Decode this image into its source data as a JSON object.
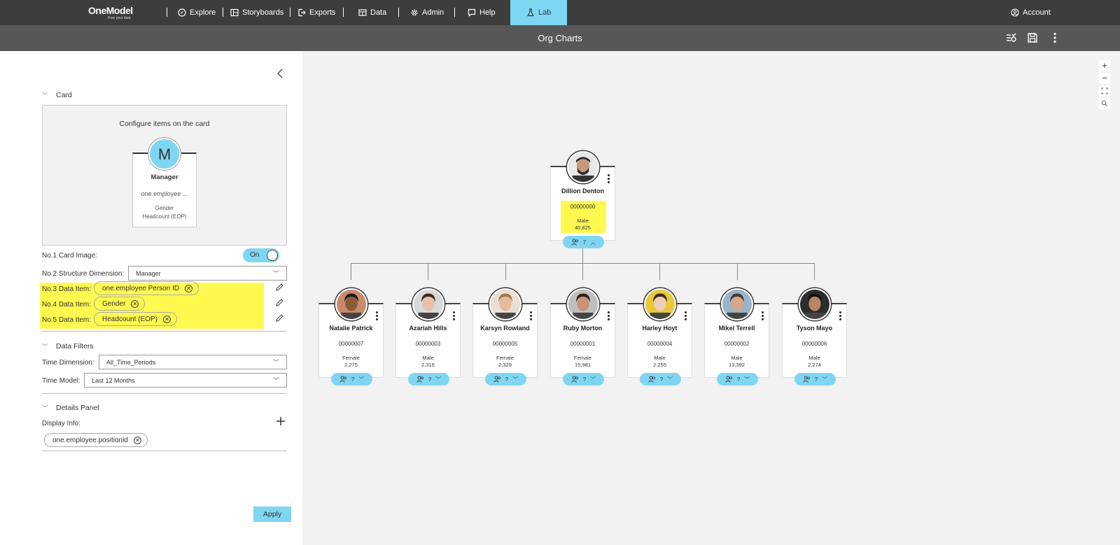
{
  "app": {
    "logo_text": "OneModel",
    "logo_tagline": "Free your data"
  },
  "nav": {
    "items": [
      {
        "label": "Explore",
        "icon": "compass-icon"
      },
      {
        "label": "Storyboards",
        "icon": "storyboard-icon"
      },
      {
        "label": "Exports",
        "icon": "export-icon"
      },
      {
        "label": "Data",
        "icon": "data-icon"
      },
      {
        "label": "Admin",
        "icon": "gear-icon"
      },
      {
        "label": "Help",
        "icon": "help-icon"
      },
      {
        "label": "Lab",
        "icon": "lab-icon",
        "active": true
      }
    ],
    "account": "Account"
  },
  "subbar": {
    "title": "Org Charts"
  },
  "panel": {
    "card_section": "Card",
    "configure_title": "Configure items on the card",
    "preview": {
      "avatar_letter": "M",
      "title": "Manager",
      "line1": "one.employee ...",
      "line2": "Gender",
      "line3": "Headcount (EOP)"
    },
    "card_image_label": "No.1 Card Image:",
    "card_image_toggle": "On",
    "structure_label": "No.2 Structure Dimension:",
    "structure_value": "Manager",
    "data_items": [
      {
        "label": "No.3 Data Item:",
        "value": "one.employee Person ID"
      },
      {
        "label": "No.4 Data Item:",
        "value": "Gender"
      },
      {
        "label": "No.5 Data Item:",
        "value": "Headcount (EOP)"
      }
    ],
    "filters_section": "Data Filters",
    "time_dimension_label": "Time Dimension:",
    "time_dimension_value": "All_Time_Periods",
    "time_model_label": "Time Model:",
    "time_model_value": "Last 12 Months",
    "details_section": "Details Panel",
    "display_info_label": "Display Info:",
    "display_info_chip": "one.employee.positionid",
    "apply": "Apply"
  },
  "zoom": {
    "in": "+",
    "out": "−"
  },
  "org": {
    "root": {
      "name": "Dillion Denton",
      "id": "00000000",
      "gender": "Male",
      "headcount": "40,825",
      "reports": "7"
    },
    "children": [
      {
        "name": "Natalie Patrick",
        "id": "00000007",
        "gender": "Female",
        "headcount": "2,275",
        "reports": "?",
        "skin": "#8a5a3c",
        "hair": "#1a1a1a",
        "bg": "#c98b6a"
      },
      {
        "name": "Azariah Hills",
        "id": "00000003",
        "gender": "Male",
        "headcount": "2,316",
        "reports": "?",
        "skin": "#e6c2a8",
        "hair": "#3a2a20",
        "bg": "#d9d9d9"
      },
      {
        "name": "Karsyn Rowland",
        "id": "00000005",
        "gender": "Female",
        "headcount": "2,329",
        "reports": "?",
        "skin": "#e7b99b",
        "hair": "#a8754a",
        "bg": "#e9dfd6"
      },
      {
        "name": "Ruby Morton",
        "id": "00000001",
        "gender": "Female",
        "headcount": "15,981",
        "reports": "?",
        "skin": "#c99473",
        "hair": "#2b1d16",
        "bg": "#bfbfbf"
      },
      {
        "name": "Harley Hoyt",
        "id": "00000004",
        "gender": "Male",
        "headcount": "2,255",
        "reports": "?",
        "skin": "#f0cdb6",
        "hair": "#3b2a1e",
        "bg": "#e8c93a"
      },
      {
        "name": "Mikel Terrell",
        "id": "00000002",
        "gender": "Male",
        "headcount": "13,392",
        "reports": "?",
        "skin": "#d8a689",
        "hair": "#4a3a30",
        "bg": "#9ab5c9"
      },
      {
        "name": "Tyson Mayo",
        "id": "00000006",
        "gender": "Male",
        "headcount": "2,274",
        "reports": "?",
        "skin": "#b98565",
        "hair": "#111",
        "bg": "#2d2d2d"
      }
    ]
  }
}
